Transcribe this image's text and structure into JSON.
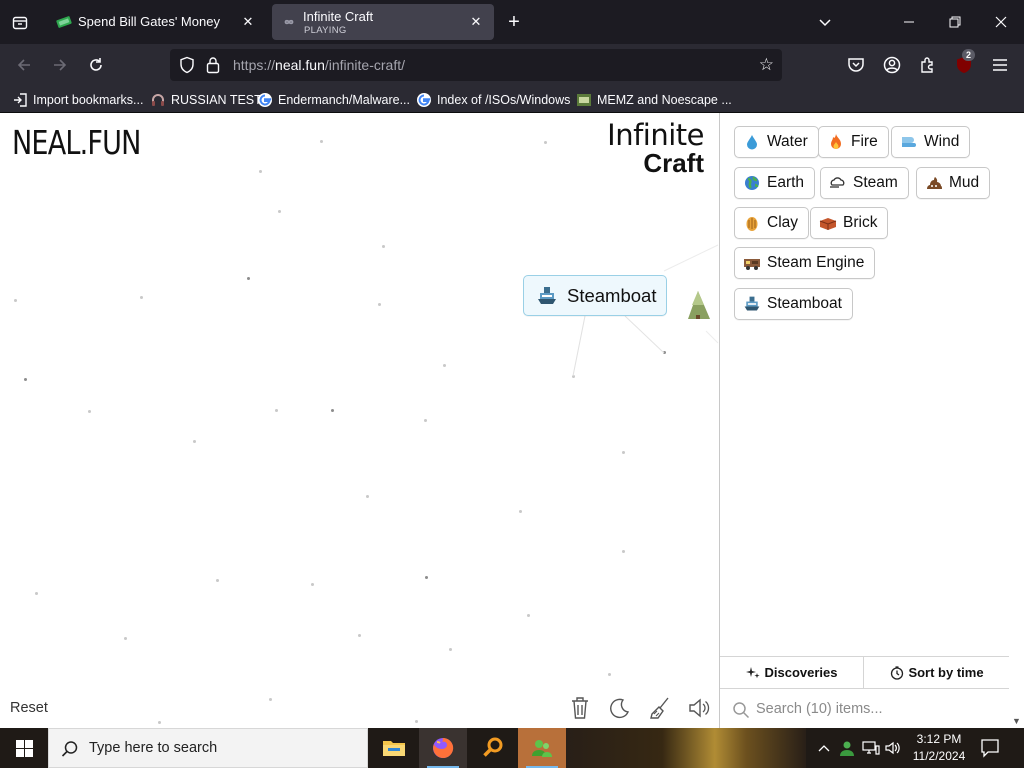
{
  "browser": {
    "tabs": [
      {
        "title": "Spend Bill Gates' Money",
        "subtitle": ""
      },
      {
        "title": "Infinite Craft",
        "subtitle": "PLAYING"
      }
    ],
    "url": {
      "prefix": "https://",
      "host": "neal.fun",
      "path": "/infinite-craft/"
    },
    "extension_badge": "2",
    "bookmarks": [
      {
        "label": "Import bookmarks...",
        "icon": "import-icon"
      },
      {
        "label": "RUSSIAN TEST",
        "icon": "headphones-icon"
      },
      {
        "label": "Endermanch/Malware...",
        "icon": "google-icon"
      },
      {
        "label": "Index of /ISOs/Windows",
        "icon": "google-icon"
      },
      {
        "label": "MEMZ and Noescape ...",
        "icon": "thumbnail-icon"
      }
    ]
  },
  "page": {
    "logo": "NEAL.FUN",
    "title_line1": "Infinite",
    "title_line2": "Craft",
    "canvas_item": {
      "label": "Steamboat",
      "emoji": "steamboat"
    },
    "reset_label": "Reset",
    "sidebar": {
      "items": [
        {
          "label": "Water",
          "emoji": "droplet"
        },
        {
          "label": "Fire",
          "emoji": "fire"
        },
        {
          "label": "Wind",
          "emoji": "wind"
        },
        {
          "label": "Earth",
          "emoji": "globe"
        },
        {
          "label": "Steam",
          "emoji": "steam-cloud"
        },
        {
          "label": "Mud",
          "emoji": "mud"
        },
        {
          "label": "Clay",
          "emoji": "clay"
        },
        {
          "label": "Brick",
          "emoji": "brick"
        },
        {
          "label": "Steam Engine",
          "emoji": "locomotive"
        },
        {
          "label": "Steamboat",
          "emoji": "steamboat"
        }
      ],
      "discoveries_label": "Discoveries",
      "sort_label": "Sort by time",
      "search_placeholder": "Search (10) items..."
    }
  },
  "taskbar": {
    "search_placeholder": "Type here to search",
    "time": "3:12 PM",
    "date": "11/2/2024"
  },
  "colors": {
    "tab_active": "#42414d",
    "toolbar": "#2b2a33",
    "accent_canvas_item": "#eef8fd"
  }
}
